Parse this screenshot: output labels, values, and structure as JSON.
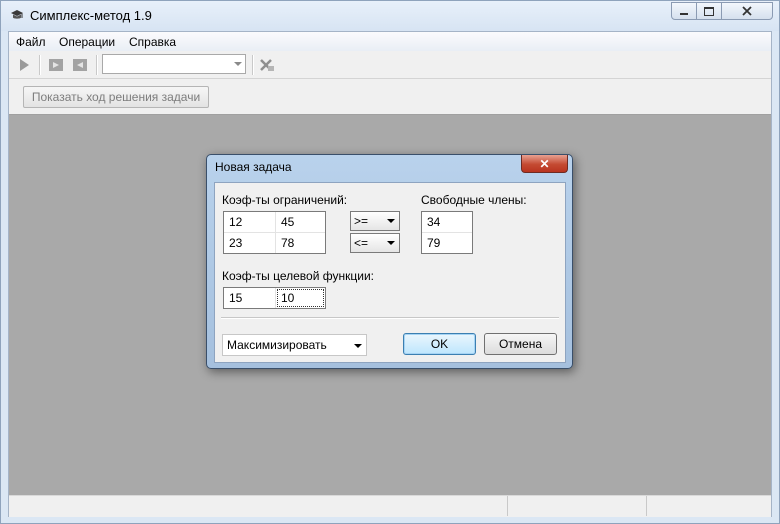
{
  "window": {
    "title": "Симплекс-метод 1.9"
  },
  "menu": [
    "Файл",
    "Операции",
    "Справка"
  ],
  "toolbar": {
    "combo_value": ""
  },
  "actions": {
    "show_solution_label": "Показать ход решения задачи"
  },
  "dialog": {
    "title": "Новая задача",
    "close_glyph": "✕",
    "constraints_label": "Коэф-ты ограничений:",
    "free_terms_label": "Свободные члены:",
    "objective_label": "Коэф-ты целевой функции:",
    "constraints": [
      [
        "12",
        "45"
      ],
      [
        "23",
        "78"
      ]
    ],
    "signs": [
      ">=",
      "<="
    ],
    "free_terms": [
      "34",
      "79"
    ],
    "objective": [
      "15",
      "10"
    ],
    "mode": "Максимизировать",
    "ok_label": "OK",
    "cancel_label": "Отмена"
  },
  "colors": {
    "workspace": "#a9a9a9",
    "dialog_frame": "#b9d2ec",
    "close_red": "#c44a32"
  }
}
